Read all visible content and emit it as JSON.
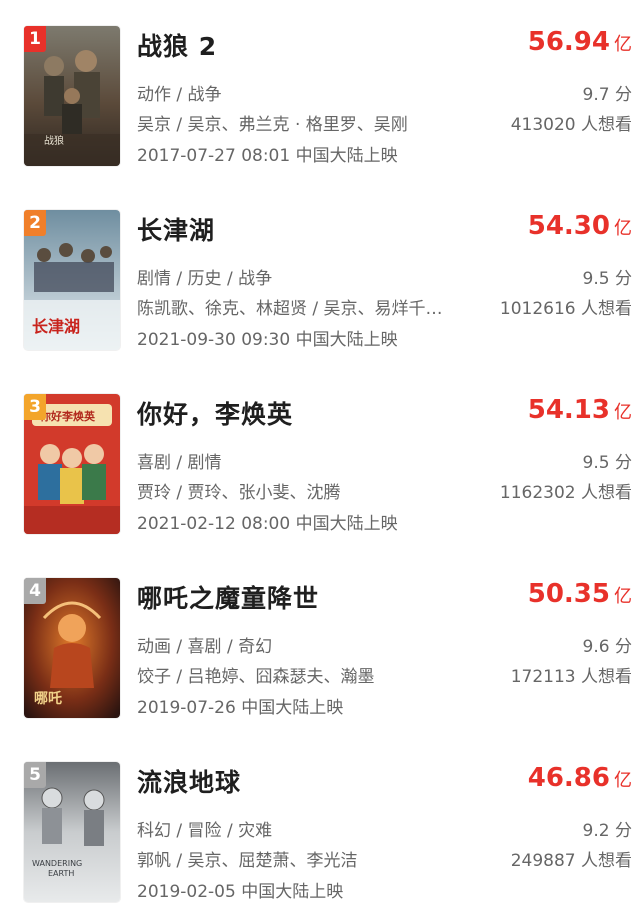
{
  "colors": {
    "accent": "#e8312a",
    "text": "#1f1f1f",
    "secondary": "#666666"
  },
  "movies": [
    {
      "rank": "1",
      "title": "战狼 2",
      "box_office": "56.94",
      "unit": "亿",
      "genres": "动作 / 战争",
      "score": "9.7 分",
      "cast": "吴京 / 吴京、弗兰克 · 格里罗、吴刚",
      "wish": "413020 人想看",
      "release": "2017-07-27 08:01 中国大陆上映"
    },
    {
      "rank": "2",
      "title": "长津湖",
      "box_office": "54.30",
      "unit": "亿",
      "genres": "剧情 / 历史 / 战争",
      "score": "9.5 分",
      "cast": "陈凯歌、徐克、林超贤 / 吴京、易烊千…",
      "wish": "1012616 人想看",
      "release": "2021-09-30 09:30 中国大陆上映"
    },
    {
      "rank": "3",
      "title": "你好，李焕英",
      "box_office": "54.13",
      "unit": "亿",
      "genres": "喜剧 / 剧情",
      "score": "9.5 分",
      "cast": "贾玲 / 贾玲、张小斐、沈腾",
      "wish": "1162302 人想看",
      "release": "2021-02-12 08:00 中国大陆上映"
    },
    {
      "rank": "4",
      "title": "哪吒之魔童降世",
      "box_office": "50.35",
      "unit": "亿",
      "genres": "动画 / 喜剧 / 奇幻",
      "score": "9.6 分",
      "cast": "饺子 / 吕艳婷、囧森瑟夫、瀚墨",
      "wish": "172113 人想看",
      "release": "2019-07-26 中国大陆上映"
    },
    {
      "rank": "5",
      "title": "流浪地球",
      "box_office": "46.86",
      "unit": "亿",
      "genres": "科幻 / 冒险 / 灾难",
      "score": "9.2 分",
      "cast": "郭帆 / 吴京、屈楚萧、李光洁",
      "wish": "249887 人想看",
      "release": "2019-02-05 中国大陆上映"
    }
  ]
}
